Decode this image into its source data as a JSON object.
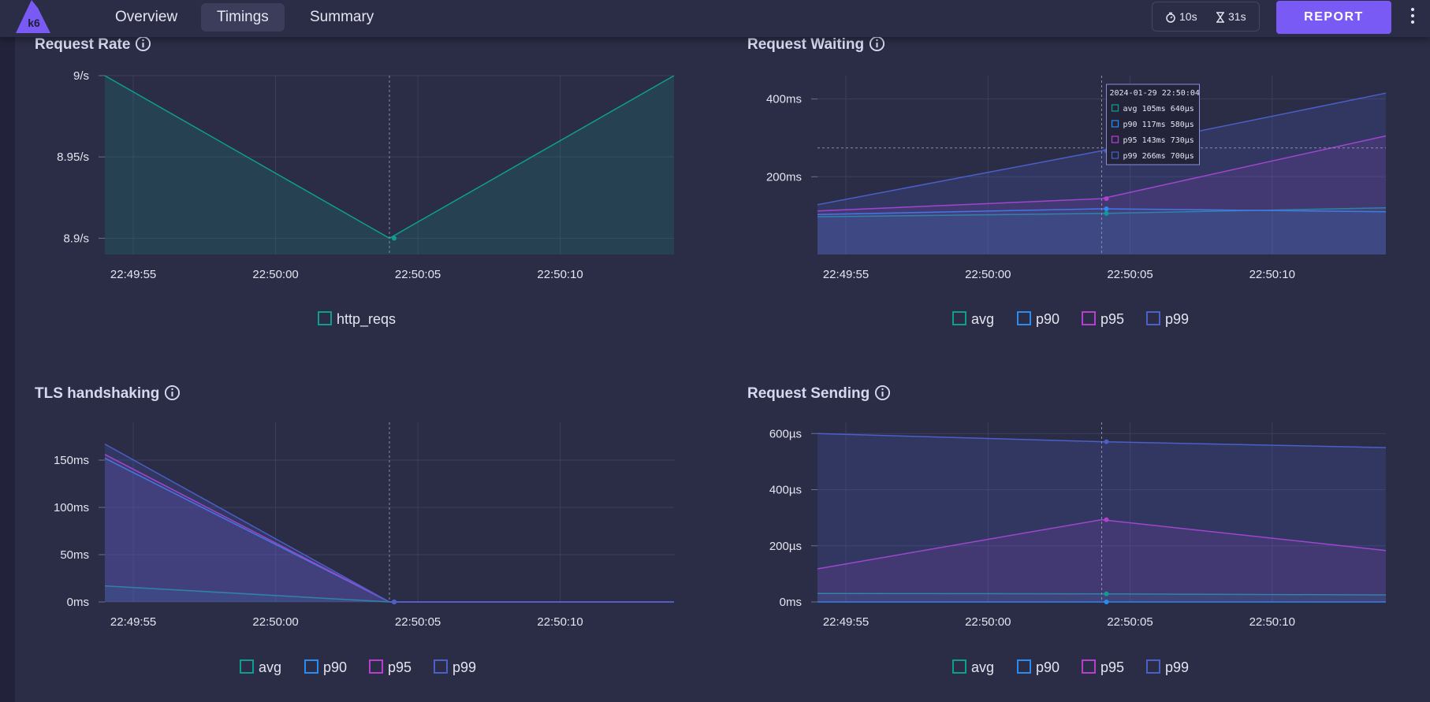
{
  "nav": {
    "logo_text": "k6",
    "tabs": [
      {
        "label": "Overview"
      },
      {
        "label": "Timings"
      },
      {
        "label": "Summary"
      }
    ],
    "duration_1": "10s",
    "duration_2": "31s",
    "report_label": "REPORT"
  },
  "colors": {
    "avg": "#0e9e8e",
    "p90": "#2b8cf0",
    "p95": "#b73fd0",
    "p99": "#4a5fc8",
    "accent": "#7a5af5"
  },
  "icons": [
    "k6-logo-icon",
    "stopwatch-icon",
    "hourglass-icon",
    "info-icon",
    "kebab-menu-icon"
  ],
  "x_ticks": [
    "22:49:55",
    "22:50:00",
    "22:50:05",
    "22:50:10"
  ],
  "chart_data": [
    {
      "type": "area",
      "title": "Request Rate",
      "x": [
        "22:49:54",
        "22:50:04",
        "22:50:14"
      ],
      "y_ticks": [
        "8.9/s",
        "8.95/s",
        "9/s"
      ],
      "ylim": [
        8.89,
        9.0
      ],
      "series": [
        {
          "name": "http_reqs",
          "values": [
            9.0,
            8.9,
            9.0
          ]
        }
      ],
      "grid": true,
      "legend": "bottom"
    },
    {
      "type": "area",
      "title": "Request Waiting",
      "x": [
        "22:49:54",
        "22:50:04",
        "22:50:14"
      ],
      "y_ticks": [
        "200ms",
        "400ms"
      ],
      "ylim": [
        0,
        460
      ],
      "series": [
        {
          "name": "avg",
          "values": [
            97,
            105.64,
            120
          ]
        },
        {
          "name": "p90",
          "values": [
            103,
            117.58,
            110
          ]
        },
        {
          "name": "p95",
          "values": [
            112,
            143.73,
            305
          ]
        },
        {
          "name": "p99",
          "values": [
            128,
            266.7,
            415
          ]
        }
      ],
      "crosshair": {
        "x": "22:50:04",
        "y": 274
      },
      "tooltip": {
        "header": "2024-01-29 22:50:04",
        "rows": [
          "avg 105ms 640µs",
          "p90 117ms 580µs",
          "p95 143ms 730µs",
          "p99 266ms 700µs"
        ]
      },
      "grid": true,
      "legend": "bottom"
    },
    {
      "type": "area",
      "title": "TLS handshaking",
      "x": [
        "22:49:54",
        "22:50:04",
        "22:50:14"
      ],
      "y_ticks": [
        "0ms",
        "50ms",
        "100ms",
        "150ms"
      ],
      "ylim": [
        0,
        190
      ],
      "series": [
        {
          "name": "avg",
          "values": [
            17,
            0,
            0
          ]
        },
        {
          "name": "p90",
          "values": [
            152,
            0,
            0
          ]
        },
        {
          "name": "p95",
          "values": [
            156,
            0,
            0
          ]
        },
        {
          "name": "p99",
          "values": [
            167,
            0,
            0
          ]
        }
      ],
      "grid": true,
      "legend": "bottom"
    },
    {
      "type": "area",
      "title": "Request Sending",
      "x": [
        "22:49:54",
        "22:50:04",
        "22:50:14"
      ],
      "y_ticks": [
        "0ms",
        "200µs",
        "400µs",
        "600µs"
      ],
      "ylim": [
        0,
        640
      ],
      "series": [
        {
          "name": "avg",
          "values": [
            30,
            29,
            25
          ]
        },
        {
          "name": "p90",
          "values": [
            0,
            0,
            0
          ]
        },
        {
          "name": "p95",
          "values": [
            118,
            293,
            183
          ]
        },
        {
          "name": "p99",
          "values": [
            600,
            571,
            550
          ]
        }
      ],
      "grid": true,
      "legend": "bottom"
    }
  ]
}
